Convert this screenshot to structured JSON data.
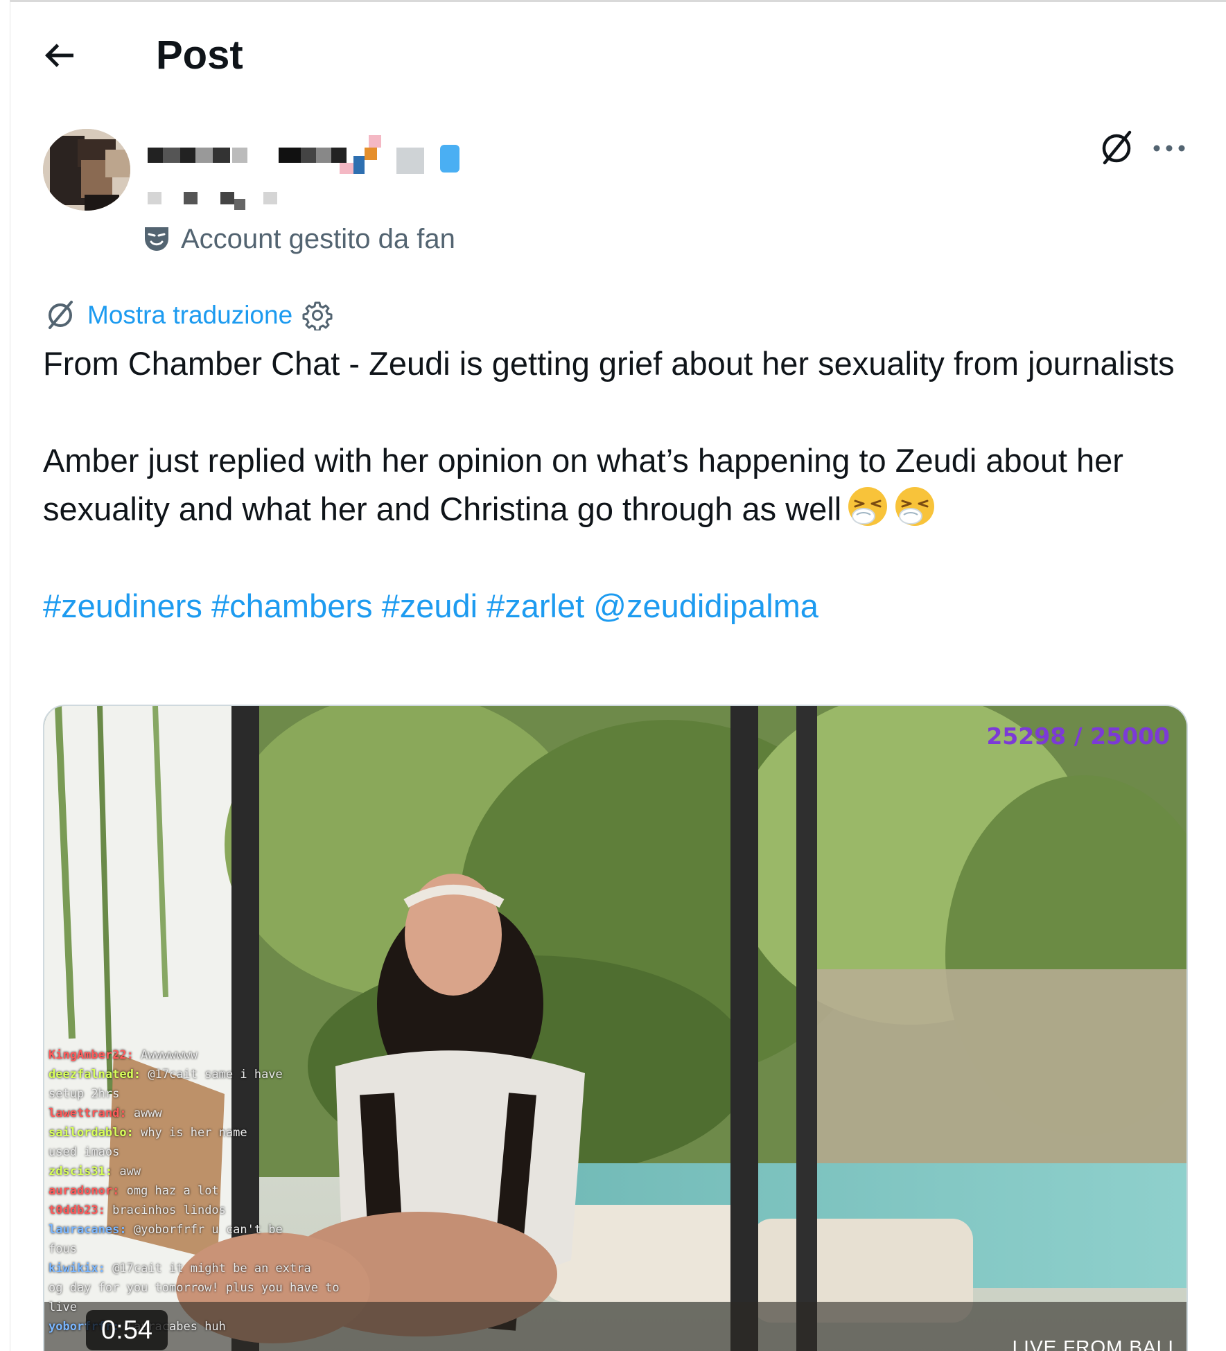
{
  "header": {
    "title": "Post"
  },
  "author": {
    "badge": "Account gestito da fan"
  },
  "translation": {
    "link": "Mostra traduzione"
  },
  "post": {
    "line1": "From Chamber Chat - Zeudi is getting grief about her sexuality from journalists",
    "line2": "Amber just replied with her opinion on what’s happening to Zeudi about her sexuality and what her and Christina go through as well",
    "emoji_name": "sneezing-face",
    "tags": [
      "#zeudiners",
      "#chambers",
      "#zeudi",
      "#zarlet",
      "@zeudidipalma"
    ]
  },
  "video": {
    "viewer_count": "25298 / 25000",
    "live_label": "LIVE FROM BALI",
    "duration": "0:54",
    "chat": [
      {
        "user": "KingAmber22:",
        "msg": "Awwwwwww"
      },
      {
        "user": "deezfalnated:",
        "msg": "@17cait same i have"
      },
      {
        "user": "",
        "msg": "setup 2hrs"
      },
      {
        "user": "lawettrand:",
        "msg": "awww"
      },
      {
        "user": "sailordablo:",
        "msg": "why is her name"
      },
      {
        "user": "",
        "msg": "used imaos"
      },
      {
        "user": "zdscis31:",
        "msg": "aww"
      },
      {
        "user": "auradonor:",
        "msg": "omg haz a lot"
      },
      {
        "user": "t0ddb23:",
        "msg": "bracinhos lindos"
      },
      {
        "user": "lauracanes:",
        "msg": "@yoborfrfr u can't be"
      },
      {
        "user": "",
        "msg": "fous"
      },
      {
        "user": "kiwikix:",
        "msg": "@17cait it might be an extra"
      },
      {
        "user": "",
        "msg": "og day for you tomorrow! plus you have to"
      },
      {
        "user": "",
        "msg": "live"
      },
      {
        "user": "yoborfrfr:",
        "msg": "lauracabes huh"
      }
    ]
  },
  "colors": {
    "link": "#1d9bf0",
    "text": "#0f1419",
    "muted": "#536471",
    "viewer_count": "#7c3ad6"
  }
}
